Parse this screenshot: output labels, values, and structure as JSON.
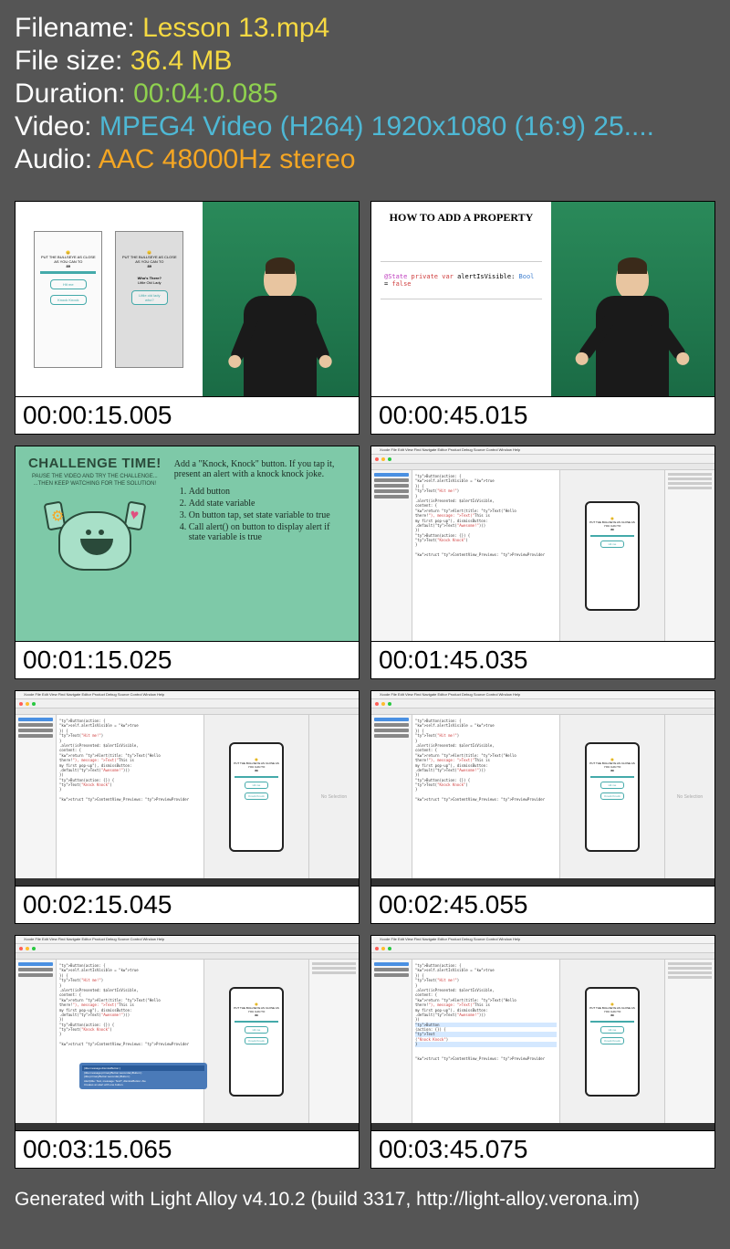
{
  "header": {
    "filename_label": "Filename: ",
    "filename_value": "Lesson 13.mp4",
    "filesize_label": "File size: ",
    "filesize_value": "36.4 MB",
    "duration_label": "Duration: ",
    "duration_value": "00:04:0.085",
    "video_label": "Video: ",
    "video_value": "MPEG4 Video (H264) 1920x1080 (16:9) 25....",
    "audio_label": "Audio: ",
    "audio_value": "AAC 48000Hz stereo"
  },
  "thumbnails": [
    {
      "timestamp": "00:00:15.005",
      "content": {
        "type": "slide-person",
        "phones": true,
        "phone_caption": "PUT THE BULLSEYE AS CLOSE AS YOU CAN TO",
        "phone_num": "89",
        "phone_btn": "Hit me",
        "phone_btn2": "Knock Knock",
        "alert_title": "Who's There?",
        "alert_sub": "Little Old Lady"
      }
    },
    {
      "timestamp": "00:00:45.015",
      "content": {
        "type": "prop-person",
        "title": "HOW TO ADD A PROPERTY",
        "code": "@State private var alertIsVisible: Bool = false"
      }
    },
    {
      "timestamp": "00:01:15.025",
      "content": {
        "type": "challenge",
        "title": "CHALLENGE TIME!",
        "sub1": "PAUSE THE VIDEO AND TRY THE CHALLENGE...",
        "sub2": "...THEN KEEP WATCHING FOR THE SOLUTION!",
        "intro": "Add a \"Knock, Knock\" button. If you tap it, present an alert with a knock knock joke.",
        "steps": [
          "Add button",
          "Add state variable",
          "On button tap, set state variable to true",
          "Call alert() on button to display alert if state variable is true"
        ]
      }
    },
    {
      "timestamp": "00:01:45.035",
      "content": {
        "type": "xcode",
        "inspector": true,
        "preview": true
      }
    },
    {
      "timestamp": "00:02:15.045",
      "content": {
        "type": "xcode",
        "preview": true,
        "noselection": true
      }
    },
    {
      "timestamp": "00:02:45.055",
      "content": {
        "type": "xcode",
        "preview": true,
        "noselection": true
      }
    },
    {
      "timestamp": "00:03:15.065",
      "content": {
        "type": "xcode",
        "preview": true,
        "inspector": true,
        "popup": true,
        "popup_lines": [
          "(title:message:dismissButton:)",
          "(title:message:primaryButton:secondaryButton:)",
          "(title:primaryButton:secondaryButton:)",
          "Alert(title: Text, message: Text?, dismissButton: Ale",
          "Creates an alert with one button."
        ]
      }
    },
    {
      "timestamp": "00:03:45.075",
      "content": {
        "type": "xcode",
        "preview": true,
        "inspector": true,
        "highlight": true
      }
    }
  ],
  "xcode_menu": [
    "Xcode",
    "File",
    "Edit",
    "View",
    "Find",
    "Navigate",
    "Editor",
    "Product",
    "Debug",
    "Source Control",
    "Window",
    "Help"
  ],
  "xcode_code_lines": [
    "Button(action: {",
    "  self.alertIsVisible = true",
    "}) {",
    "  Text(\"Hit me!\")",
    "}",
    ".alert(isPresented: $alertIsVisible,",
    "  content: {",
    "  return Alert(title: Text(\"Hello",
    "  there!\"), message: Text(\"This is",
    "  my first pop-up\"), dismissButton:",
    "  .default(Text(\"Awesome!\")))",
    "})",
    "Button(action: {}) {",
    "  Text(\"Knock Knock\")",
    "}",
    "",
    "struct ContentView_Previews: PreviewProvider"
  ],
  "preview_text": {
    "caption": "PUT THE BULLSEYE AS CLOSE AS YOU CAN TO",
    "num": "89",
    "btn1": "Hit me",
    "btn2": "Knock Knock"
  },
  "footer": "Generated with Light Alloy v4.10.2 (build 3317, http://light-alloy.verona.im)"
}
